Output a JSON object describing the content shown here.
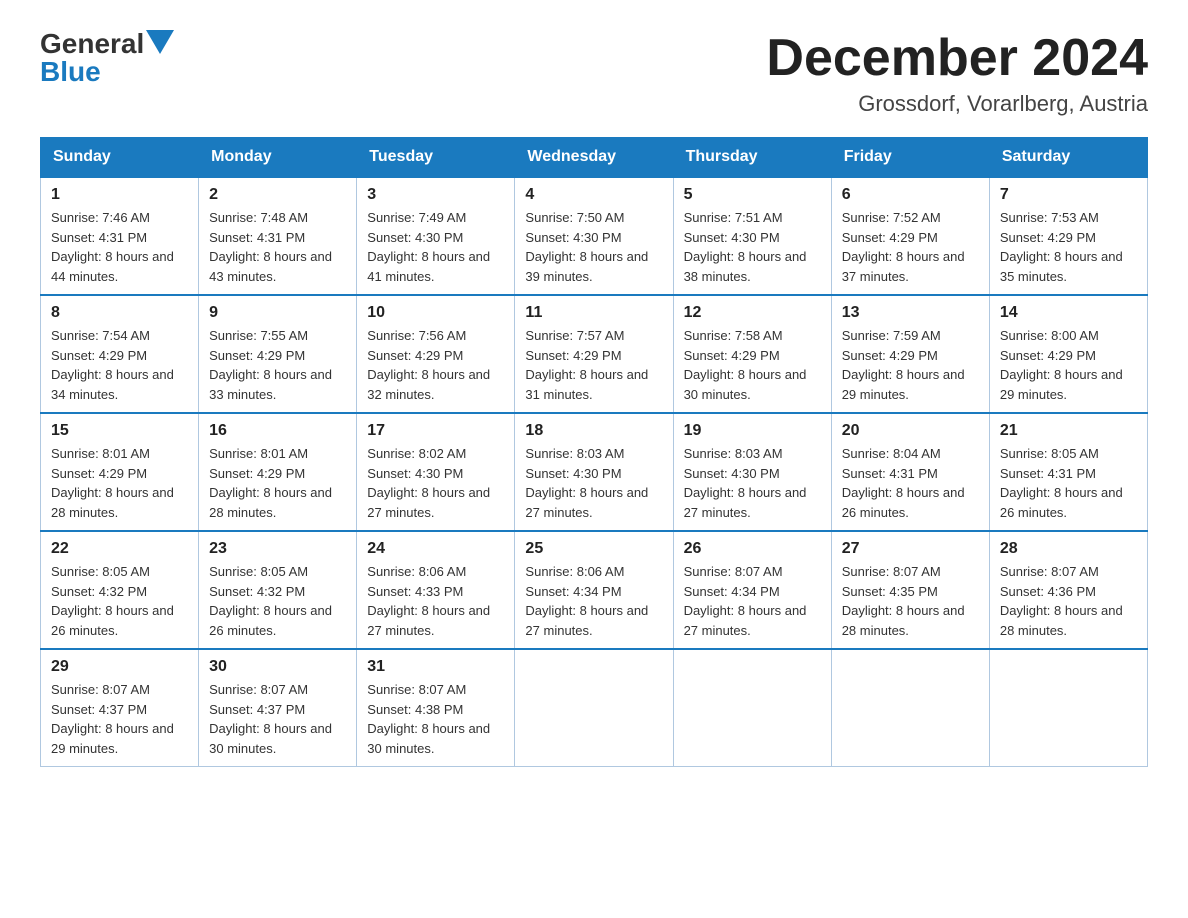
{
  "logo": {
    "general": "General",
    "blue": "Blue"
  },
  "title": "December 2024",
  "location": "Grossdorf, Vorarlberg, Austria",
  "weekdays": [
    "Sunday",
    "Monday",
    "Tuesday",
    "Wednesday",
    "Thursday",
    "Friday",
    "Saturday"
  ],
  "weeks": [
    [
      {
        "day": "1",
        "sunrise": "7:46 AM",
        "sunset": "4:31 PM",
        "daylight": "8 hours and 44 minutes."
      },
      {
        "day": "2",
        "sunrise": "7:48 AM",
        "sunset": "4:31 PM",
        "daylight": "8 hours and 43 minutes."
      },
      {
        "day": "3",
        "sunrise": "7:49 AM",
        "sunset": "4:30 PM",
        "daylight": "8 hours and 41 minutes."
      },
      {
        "day": "4",
        "sunrise": "7:50 AM",
        "sunset": "4:30 PM",
        "daylight": "8 hours and 39 minutes."
      },
      {
        "day": "5",
        "sunrise": "7:51 AM",
        "sunset": "4:30 PM",
        "daylight": "8 hours and 38 minutes."
      },
      {
        "day": "6",
        "sunrise": "7:52 AM",
        "sunset": "4:29 PM",
        "daylight": "8 hours and 37 minutes."
      },
      {
        "day": "7",
        "sunrise": "7:53 AM",
        "sunset": "4:29 PM",
        "daylight": "8 hours and 35 minutes."
      }
    ],
    [
      {
        "day": "8",
        "sunrise": "7:54 AM",
        "sunset": "4:29 PM",
        "daylight": "8 hours and 34 minutes."
      },
      {
        "day": "9",
        "sunrise": "7:55 AM",
        "sunset": "4:29 PM",
        "daylight": "8 hours and 33 minutes."
      },
      {
        "day": "10",
        "sunrise": "7:56 AM",
        "sunset": "4:29 PM",
        "daylight": "8 hours and 32 minutes."
      },
      {
        "day": "11",
        "sunrise": "7:57 AM",
        "sunset": "4:29 PM",
        "daylight": "8 hours and 31 minutes."
      },
      {
        "day": "12",
        "sunrise": "7:58 AM",
        "sunset": "4:29 PM",
        "daylight": "8 hours and 30 minutes."
      },
      {
        "day": "13",
        "sunrise": "7:59 AM",
        "sunset": "4:29 PM",
        "daylight": "8 hours and 29 minutes."
      },
      {
        "day": "14",
        "sunrise": "8:00 AM",
        "sunset": "4:29 PM",
        "daylight": "8 hours and 29 minutes."
      }
    ],
    [
      {
        "day": "15",
        "sunrise": "8:01 AM",
        "sunset": "4:29 PM",
        "daylight": "8 hours and 28 minutes."
      },
      {
        "day": "16",
        "sunrise": "8:01 AM",
        "sunset": "4:29 PM",
        "daylight": "8 hours and 28 minutes."
      },
      {
        "day": "17",
        "sunrise": "8:02 AM",
        "sunset": "4:30 PM",
        "daylight": "8 hours and 27 minutes."
      },
      {
        "day": "18",
        "sunrise": "8:03 AM",
        "sunset": "4:30 PM",
        "daylight": "8 hours and 27 minutes."
      },
      {
        "day": "19",
        "sunrise": "8:03 AM",
        "sunset": "4:30 PM",
        "daylight": "8 hours and 27 minutes."
      },
      {
        "day": "20",
        "sunrise": "8:04 AM",
        "sunset": "4:31 PM",
        "daylight": "8 hours and 26 minutes."
      },
      {
        "day": "21",
        "sunrise": "8:05 AM",
        "sunset": "4:31 PM",
        "daylight": "8 hours and 26 minutes."
      }
    ],
    [
      {
        "day": "22",
        "sunrise": "8:05 AM",
        "sunset": "4:32 PM",
        "daylight": "8 hours and 26 minutes."
      },
      {
        "day": "23",
        "sunrise": "8:05 AM",
        "sunset": "4:32 PM",
        "daylight": "8 hours and 26 minutes."
      },
      {
        "day": "24",
        "sunrise": "8:06 AM",
        "sunset": "4:33 PM",
        "daylight": "8 hours and 27 minutes."
      },
      {
        "day": "25",
        "sunrise": "8:06 AM",
        "sunset": "4:34 PM",
        "daylight": "8 hours and 27 minutes."
      },
      {
        "day": "26",
        "sunrise": "8:07 AM",
        "sunset": "4:34 PM",
        "daylight": "8 hours and 27 minutes."
      },
      {
        "day": "27",
        "sunrise": "8:07 AM",
        "sunset": "4:35 PM",
        "daylight": "8 hours and 28 minutes."
      },
      {
        "day": "28",
        "sunrise": "8:07 AM",
        "sunset": "4:36 PM",
        "daylight": "8 hours and 28 minutes."
      }
    ],
    [
      {
        "day": "29",
        "sunrise": "8:07 AM",
        "sunset": "4:37 PM",
        "daylight": "8 hours and 29 minutes."
      },
      {
        "day": "30",
        "sunrise": "8:07 AM",
        "sunset": "4:37 PM",
        "daylight": "8 hours and 30 minutes."
      },
      {
        "day": "31",
        "sunrise": "8:07 AM",
        "sunset": "4:38 PM",
        "daylight": "8 hours and 30 minutes."
      },
      null,
      null,
      null,
      null
    ]
  ]
}
